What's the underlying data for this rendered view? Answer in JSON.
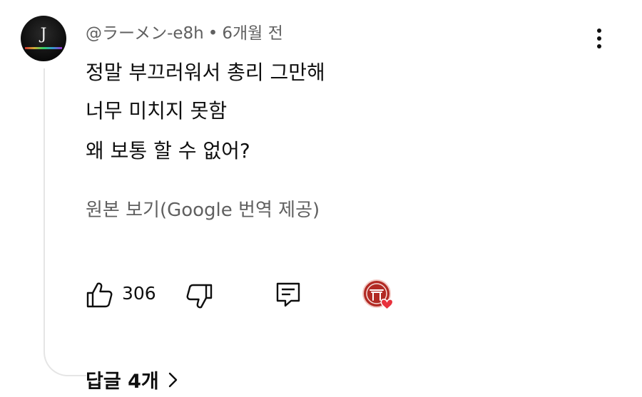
{
  "comment": {
    "avatar_letter": "J",
    "author": "@ラーメン-e8h",
    "separator": "•",
    "time_ago": "6개월 전",
    "lines": [
      "정말 부끄러워서 총리 그만해",
      "너무 미치지 못함",
      "왜 보통 할 수 없어?"
    ],
    "translate_label": "원본 보기(Google 번역 제공)",
    "like_count": "306",
    "replies_label": "답글 4개"
  },
  "icons": {
    "more": "more-vert-icon",
    "like": "thumbs-up-icon",
    "dislike": "thumbs-down-icon",
    "reply": "comment-reply-icon",
    "heart": "creator-heart-icon",
    "chevron": "chevron-right-icon"
  },
  "colors": {
    "primary_text": "#0f0f0f",
    "secondary_text": "#606060",
    "heart": "#e8313c",
    "heart_badge_bg": "#b22a24"
  }
}
